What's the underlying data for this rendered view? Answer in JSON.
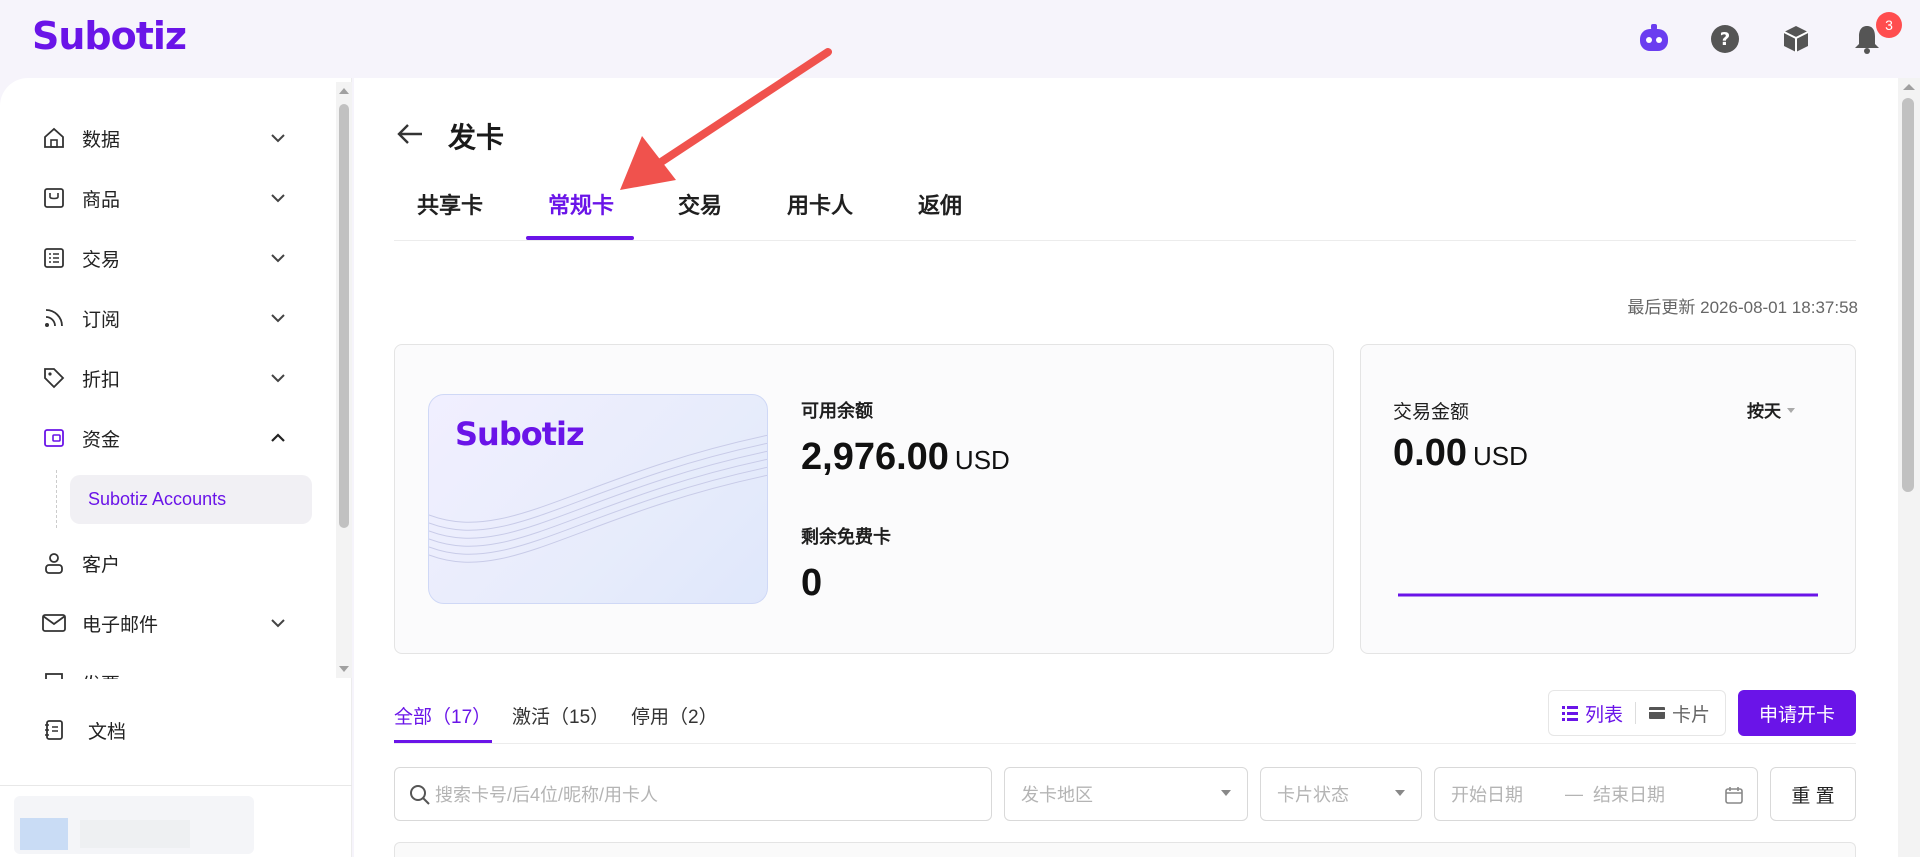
{
  "app": {
    "logo": "Subotiz",
    "notification_count": "3"
  },
  "sidebar": {
    "items": [
      {
        "label": "数据",
        "icon": "home-icon",
        "expanded": false
      },
      {
        "label": "商品",
        "icon": "store-icon",
        "expanded": false
      },
      {
        "label": "交易",
        "icon": "list-icon",
        "expanded": false
      },
      {
        "label": "订阅",
        "icon": "rss-icon",
        "expanded": false
      },
      {
        "label": "折扣",
        "icon": "tag-icon",
        "expanded": false
      },
      {
        "label": "资金",
        "icon": "wallet-icon",
        "expanded": true
      },
      {
        "label": "客户",
        "icon": "user-icon",
        "expanded": false
      },
      {
        "label": "电子邮件",
        "icon": "mail-icon",
        "expanded": false
      },
      {
        "label": "发票",
        "icon": "invoice-icon",
        "expanded": false
      }
    ],
    "sub_item": "Subotiz Accounts",
    "docs_label": "文档"
  },
  "page": {
    "title": "发卡",
    "tabs": [
      "共享卡",
      "常规卡",
      "交易",
      "用卡人",
      "返佣"
    ],
    "active_tab": "常规卡",
    "last_update": "最后更新 2026-08-01 18:37:58"
  },
  "balance": {
    "card_logo": "Subotiz",
    "available_label": "可用余额",
    "available_value": "2,976.00",
    "currency": "USD",
    "free_cards_label": "剩余免费卡",
    "free_cards_value": "0"
  },
  "transactions": {
    "label": "交易金额",
    "value": "0.00",
    "currency": "USD",
    "range": "按天"
  },
  "filters": {
    "tabs": [
      "全部（17）",
      "激活（15）",
      "停用（2）"
    ],
    "view_list": "列表",
    "view_card": "卡片",
    "apply_button": "申请开卡",
    "search_placeholder": "搜索卡号/后4位/昵称/用卡人",
    "region_placeholder": "发卡地区",
    "status_placeholder": "卡片状态",
    "start_date": "开始日期",
    "date_sep": "—",
    "end_date": "结束日期",
    "reset_button": "重 置"
  },
  "colors": {
    "accent": "#6a14e8",
    "badge": "#ff4d4f",
    "annotation_arrow": "#f0524d"
  }
}
